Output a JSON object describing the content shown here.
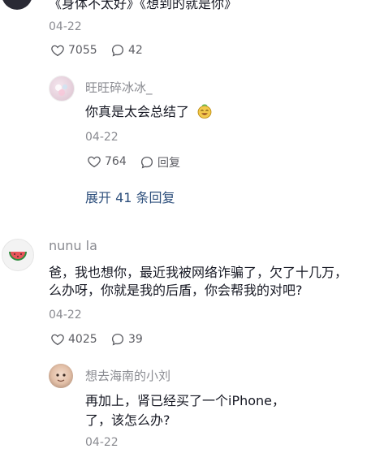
{
  "comment1": {
    "text_tail": "《身体不太好》《想到的就是你》",
    "date": "04-22",
    "likes": "7055",
    "replies": "42",
    "reply": {
      "username": "旺旺碎冰冰_",
      "text": "你真是太会总结了",
      "date": "04-22",
      "likes": "764",
      "reply_label": "回复"
    },
    "expand_label": "展开 41 条回复"
  },
  "comment2": {
    "username": "nunu la",
    "text_line1": "爸，我也想你，最近我被网络诈骗了，欠了十几万，",
    "text_line2": "么办呀，你就是我的后盾，你会帮我的对吧?",
    "date": "04-22",
    "likes": "4025",
    "replies": "39",
    "reply": {
      "username": "想去海南的小刘",
      "text_line1": "再加上，肾已经买了一个iPhone，",
      "text_line2": "了，该怎么办?",
      "date": "04-22"
    }
  }
}
